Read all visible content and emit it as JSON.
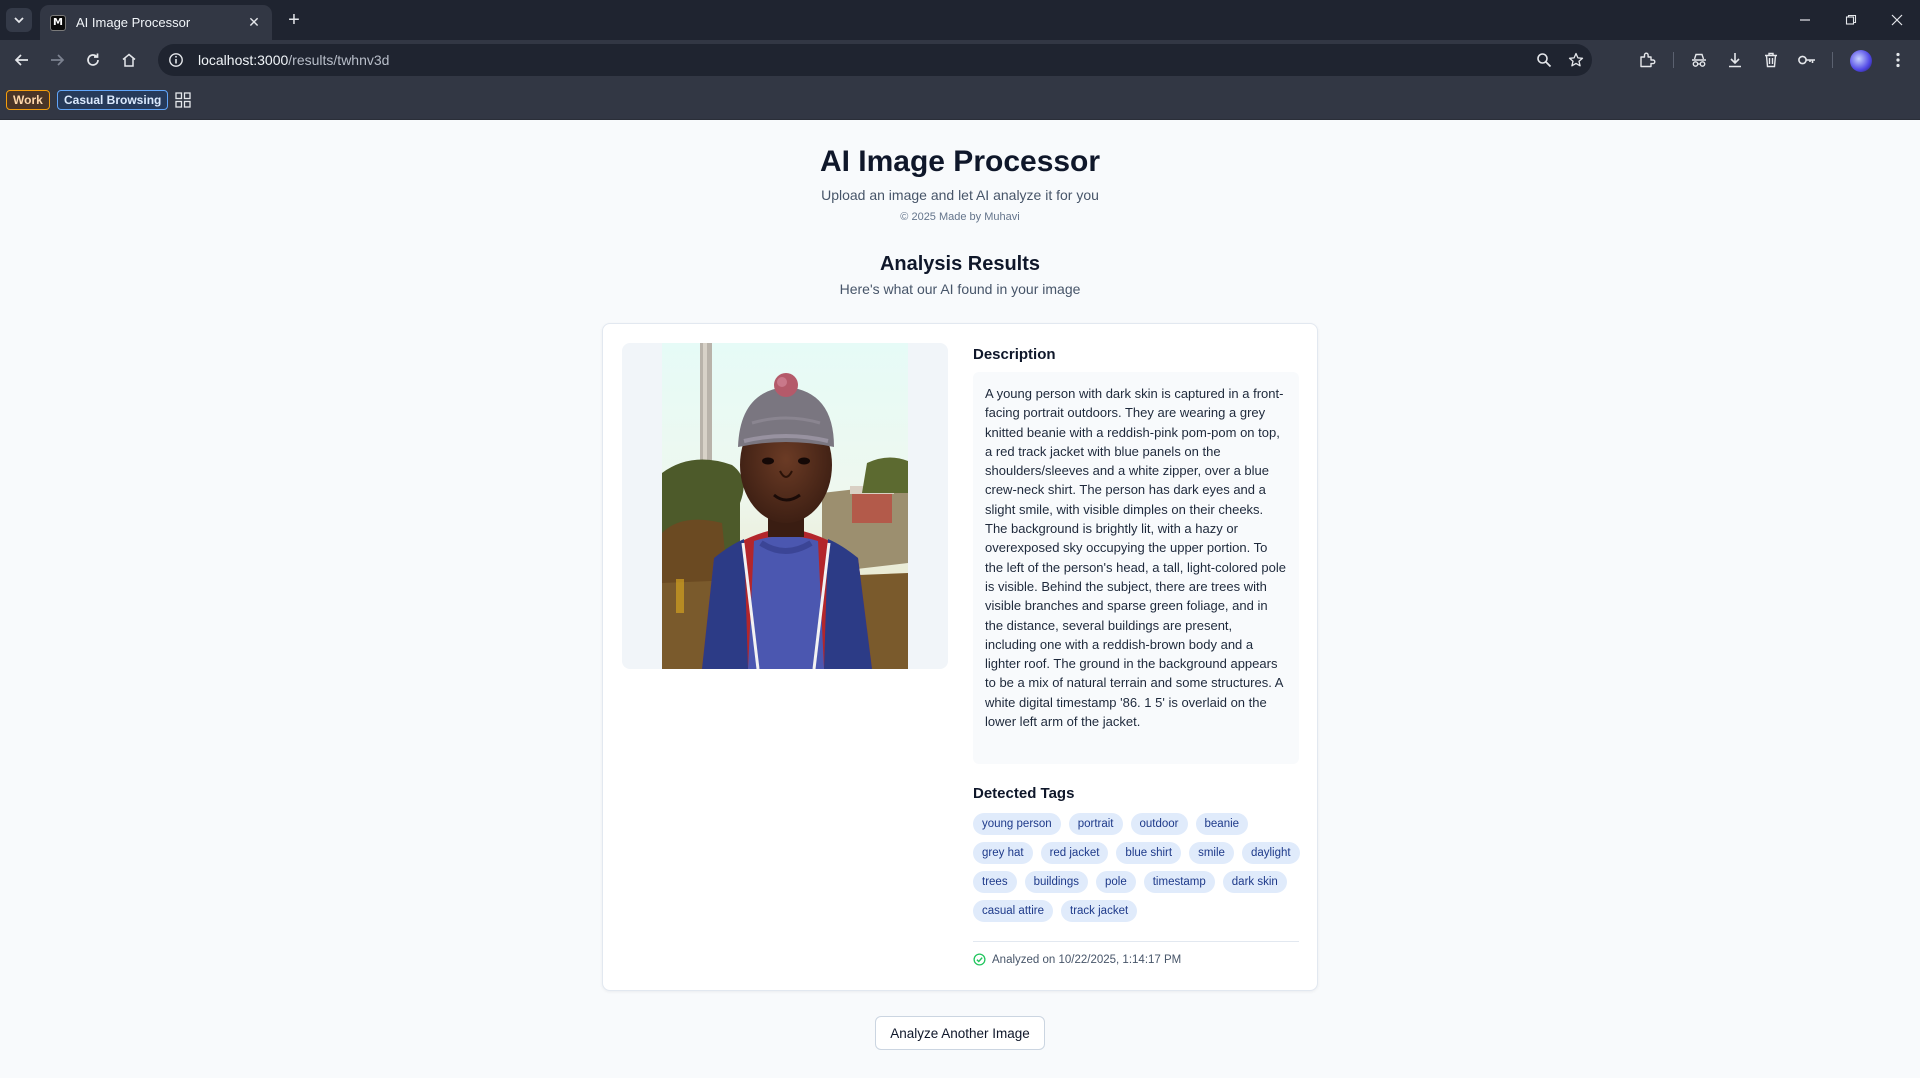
{
  "browser": {
    "tab_title": "AI Image Processor",
    "favicon_letter": "M",
    "url_host": "localhost:3000",
    "url_path": "/results/twhnv3d",
    "bookmarks": [
      "Work",
      "Casual Browsing"
    ]
  },
  "header": {
    "title": "AI Image Processor",
    "subtitle": "Upload an image and let AI analyze it for you",
    "credit": "© 2025 Made by Muhavi"
  },
  "results": {
    "title": "Analysis Results",
    "subtitle": "Here's what our AI found in your image",
    "description_heading": "Description",
    "description": "A young person with dark skin is captured in a front-facing portrait outdoors. They are wearing a grey knitted beanie with a reddish-pink pom-pom on top, a red track jacket with blue panels on the shoulders/sleeves and a white zipper, over a blue crew-neck shirt. The person has dark eyes and a slight smile, with visible dimples on their cheeks. The background is brightly lit, with a hazy or overexposed sky occupying the upper portion. To the left of the person's head, a tall, light-colored pole is visible. Behind the subject, there are trees with visible branches and sparse green foliage, and in the distance, several buildings are present, including one with a reddish-brown body and a lighter roof. The ground in the background appears to be a mix of natural terrain and some structures. A white digital timestamp '86. 1 5' is overlaid on the lower left arm of the jacket.",
    "tags_heading": "Detected Tags",
    "tags": [
      "young person",
      "portrait",
      "outdoor",
      "beanie",
      "grey hat",
      "red jacket",
      "blue shirt",
      "smile",
      "daylight",
      "trees",
      "buildings",
      "pole",
      "timestamp",
      "dark skin",
      "casual attire",
      "track jacket"
    ],
    "analyzed_text": "Analyzed on 10/22/2025, 1:14:17 PM"
  },
  "actions": {
    "analyze_another_label": "Analyze Another Image"
  },
  "colors": {
    "page_bg": "#f8fafc",
    "tag_bg": "#e0ebfb",
    "tag_text": "#1e3a8a",
    "success": "#22c55e"
  },
  "icons": [
    "tab-search-icon",
    "back-icon",
    "forward-icon",
    "reload-icon",
    "home-icon",
    "site-info-icon",
    "zoom-icon",
    "star-icon",
    "extensions-icon",
    "incognito-icon",
    "download-icon",
    "trash-icon",
    "password-key-icon",
    "menu-kebab-icon",
    "apps-grid-icon",
    "check-circle-icon"
  ]
}
